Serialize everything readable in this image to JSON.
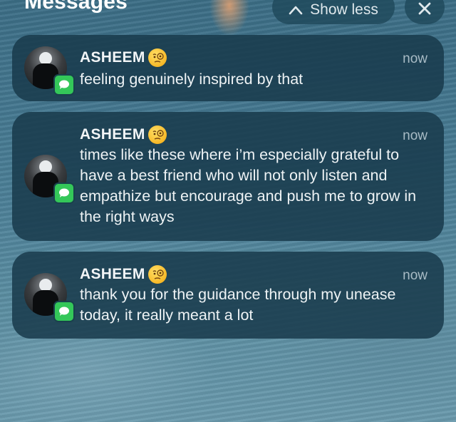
{
  "header": {
    "title": "Messages",
    "show_less_label": "Show less",
    "close_icon": "close-icon"
  },
  "notifications": [
    {
      "sender": "ASHEEM",
      "sender_emoji": "face-with-monocle",
      "time": "now",
      "message": "feeling genuinely inspired by that",
      "app_icon": "messages-icon"
    },
    {
      "sender": "ASHEEM",
      "sender_emoji": "face-with-monocle",
      "time": "now",
      "message": "times like these where i’m especially grateful to have a best friend who will not only listen and empathize but encourage and push me to grow in the right ways",
      "app_icon": "messages-icon"
    },
    {
      "sender": "ASHEEM",
      "sender_emoji": "face-with-monocle",
      "time": "now",
      "message": "thank you for the guidance through my unease today, it really meant a lot",
      "app_icon": "messages-icon"
    }
  ],
  "colors": {
    "card_background": "#183a4c",
    "messages_green": "#34c759",
    "secondary_text": "#a9bcc6"
  }
}
